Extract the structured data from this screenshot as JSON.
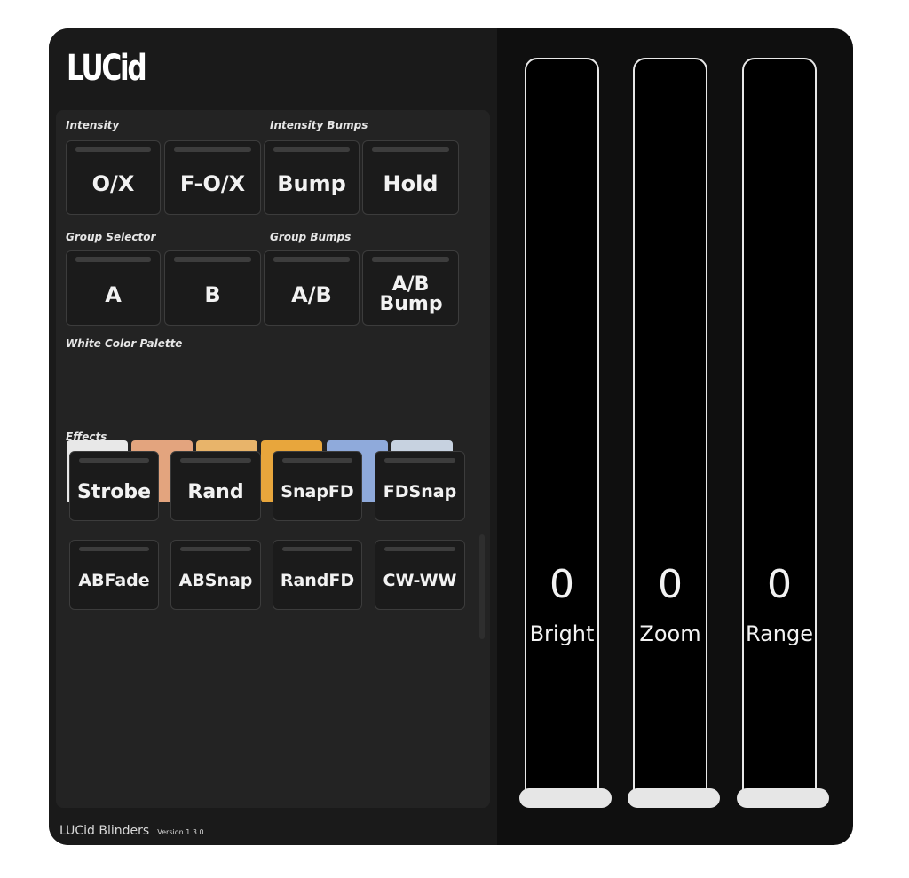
{
  "app": {
    "logo": "LUCid",
    "footer_title": "LUCid Blinders",
    "footer_version": "Version 1.3.0"
  },
  "intensity": {
    "label": "Intensity",
    "buttons": [
      "O/X",
      "F-O/X"
    ]
  },
  "intensity_bumps": {
    "label": "Intensity Bumps",
    "buttons": [
      "Bump",
      "Hold"
    ]
  },
  "group_selector": {
    "label": "Group Selector",
    "buttons": [
      "A",
      "B"
    ]
  },
  "group_bumps": {
    "label": "Group Bumps",
    "buttons": [
      "A/B",
      "A/B Bump"
    ]
  },
  "palette": {
    "label": "White Color Palette",
    "colors": [
      "#e8e8e8",
      "#e3a47e",
      "#e8b46a",
      "#e8a63c",
      "#8faadb",
      "#c7d2e0"
    ]
  },
  "effects": {
    "label": "Effects",
    "row1": [
      "Strobe",
      "Rand",
      "SnapFD",
      "FDSnap"
    ],
    "row2": [
      "ABFade",
      "ABSnap",
      "RandFD",
      "CW-WW"
    ]
  },
  "faders": [
    {
      "name": "Bright",
      "value": "0"
    },
    {
      "name": "Zoom",
      "value": "0"
    },
    {
      "name": "Range",
      "value": "0"
    }
  ]
}
